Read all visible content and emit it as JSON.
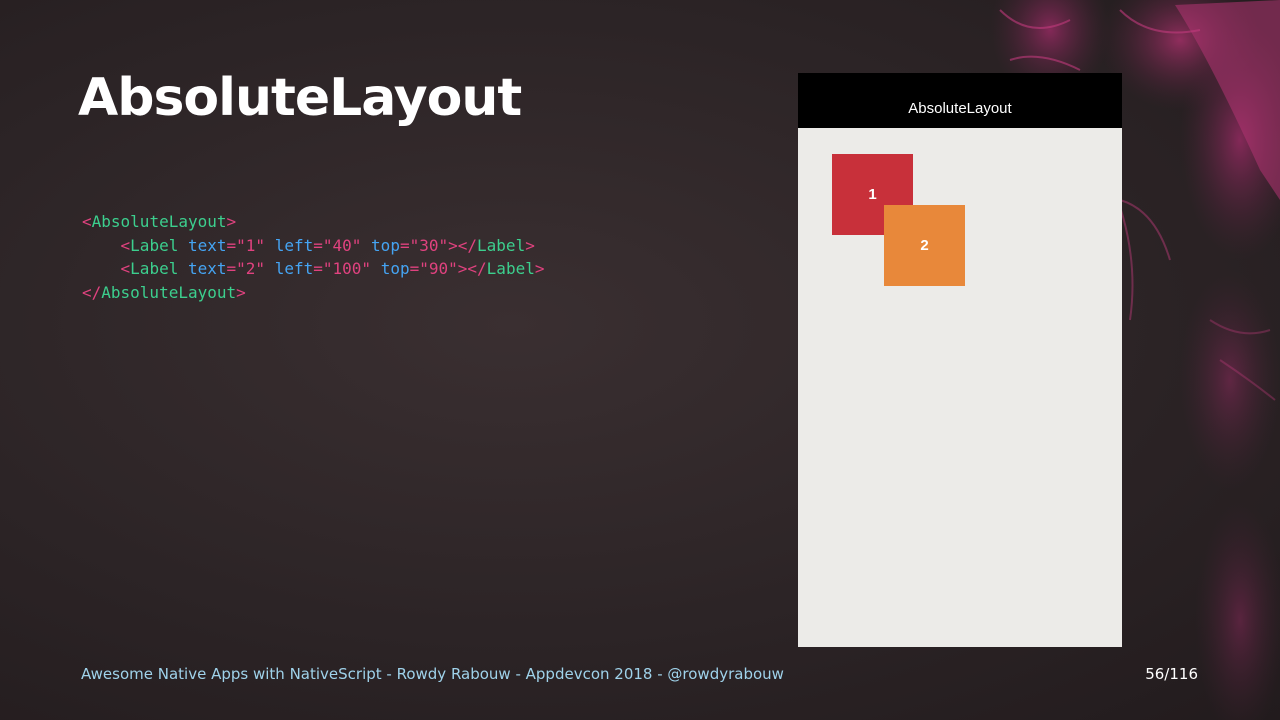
{
  "slide": {
    "title": "AbsoluteLayout",
    "footer": "Awesome Native Apps with NativeScript - Rowdy Rabouw - Appdevcon 2018 - @rowdyrabouw",
    "page_number": "56/116"
  },
  "code": {
    "open_root": "AbsoluteLayout",
    "label_tag": "Label",
    "close_root": "AbsoluteLayout",
    "attr_text": "text",
    "attr_left": "left",
    "attr_top": "top",
    "line1": {
      "text": "\"1\"",
      "left": "\"40\"",
      "top": "\"30\""
    },
    "line2": {
      "text": "\"2\"",
      "left": "\"100\"",
      "top": "\"90\""
    }
  },
  "phone": {
    "action_bar_title": "AbsoluteLayout",
    "labels": [
      {
        "text": "1",
        "color": "#c8303a"
      },
      {
        "text": "2",
        "color": "#e8883a"
      }
    ]
  },
  "colors": {
    "background": "#2c2426",
    "tag": "#3ccf8e",
    "attribute": "#45a4f3",
    "punctuation": "#e0427f",
    "footer": "#9fd2ea"
  }
}
